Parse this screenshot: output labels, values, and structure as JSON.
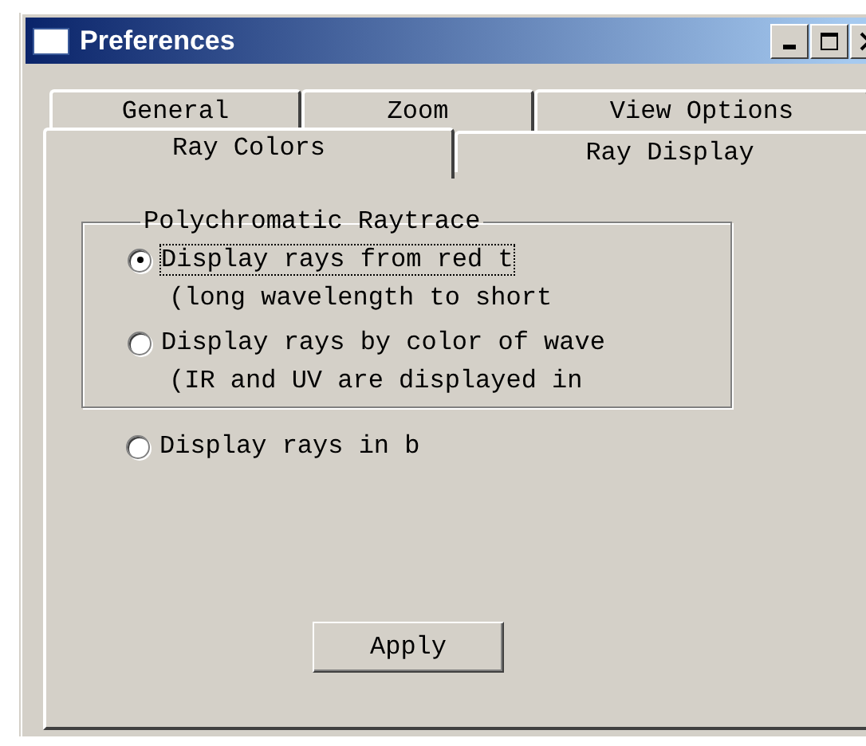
{
  "window": {
    "title": "Preferences"
  },
  "tab_rows": [
    [
      {
        "label": "General",
        "selected": false
      },
      {
        "label": "Zoom",
        "selected": false
      },
      {
        "label": "View Options",
        "selected": false
      }
    ],
    [
      {
        "label": "Ray Colors",
        "selected": true
      },
      {
        "label": "Ray Display",
        "selected": false
      }
    ]
  ],
  "group": {
    "title": "Polychromatic Raytrace",
    "options": [
      {
        "label": "Display rays from red t",
        "note": "(long wavelength to short",
        "selected": true,
        "focused": true
      },
      {
        "label": "Display rays by color of wave",
        "note": "(IR and UV are displayed in",
        "selected": false,
        "focused": false
      }
    ]
  },
  "extra_options": [
    {
      "label": "Display rays in b",
      "selected": false,
      "focused": false
    }
  ],
  "buttons": [
    "Apply"
  ]
}
